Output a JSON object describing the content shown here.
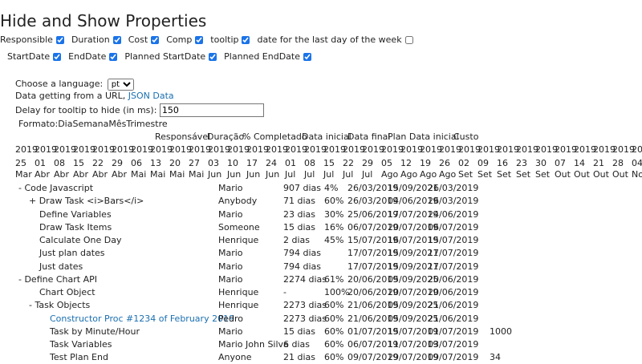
{
  "title": "Hide and Show Properties",
  "options_row1": [
    {
      "label": "Responsible",
      "checked": true
    },
    {
      "label": "Duration",
      "checked": true
    },
    {
      "label": "Cost",
      "checked": true
    },
    {
      "label": "Comp",
      "checked": true
    },
    {
      "label": "tooltip",
      "checked": true
    },
    {
      "label": "date for the last day of the week",
      "checked": false
    }
  ],
  "options_row2": [
    {
      "label": "StartDate",
      "checked": true
    },
    {
      "label": "EndDate",
      "checked": true
    },
    {
      "label": "Planned StartDate",
      "checked": true
    },
    {
      "label": "Planned EndDate",
      "checked": true
    }
  ],
  "language": {
    "label": "Choose a language:",
    "selected": "pt"
  },
  "data_source": {
    "text": "Data getting from a URL,",
    "link": "JSON Data"
  },
  "delay": {
    "label": "Delay for tooltip to hide (in ms):",
    "value": "150"
  },
  "format_label": "Formato:DiaSemanaMêsTrimestre",
  "columns": {
    "responsible": "Responsável",
    "duration": "Duração",
    "completed": "% Completado",
    "start": "Data inicial",
    "end": "Data final",
    "plan_start": "Plan Data inicial",
    "cost": "Custo"
  },
  "timeline": {
    "years": [
      "2019",
      "2019",
      "2019",
      "2019",
      "2019",
      "2019",
      "2019",
      "2019",
      "2019",
      "2019",
      "2019",
      "2019",
      "2019",
      "2019",
      "2019",
      "2019",
      "2019",
      "2019",
      "2019",
      "2019",
      "2019",
      "2019",
      "2019",
      "2019",
      "2019",
      "2019",
      "2019",
      "2019",
      "2019",
      "2019",
      "2019",
      "2019",
      "2019",
      "2019"
    ],
    "days": [
      "25",
      "01",
      "08",
      "15",
      "22",
      "29",
      "06",
      "13",
      "20",
      "27",
      "03",
      "10",
      "17",
      "24",
      "01",
      "08",
      "15",
      "22",
      "29",
      "05",
      "12",
      "19",
      "26",
      "02",
      "09",
      "16",
      "23",
      "30",
      "07",
      "14",
      "21",
      "28",
      "04",
      ""
    ],
    "months": [
      "Mar",
      "Abr",
      "Abr",
      "Abr",
      "Abr",
      "Abr",
      "Mai",
      "Mai",
      "Mai",
      "Mai",
      "Jun",
      "Jun",
      "Jun",
      "Jun",
      "Jul",
      "Jul",
      "Jul",
      "Jul",
      "Jul",
      "Ago",
      "Ago",
      "Ago",
      "Ago",
      "Set",
      "Set",
      "Set",
      "Set",
      "Set",
      "Out",
      "Out",
      "Out",
      "Out",
      "Nov",
      ""
    ]
  },
  "tasks": [
    {
      "name": "- Code Javascript",
      "indent": 0,
      "link": false,
      "responsible": "Mario",
      "duration": "907 dias",
      "completed": "4%",
      "start": "26/03/2019",
      "end": "15/09/2021",
      "plan_start": "26/03/2019",
      "cost": ""
    },
    {
      "name": "+ Draw Task <i>Bars</i>",
      "indent": 1,
      "link": false,
      "responsible": "Anybody",
      "duration": "71 dias",
      "completed": "60%",
      "start": "26/03/2019",
      "end": "04/06/2019",
      "plan_start": "26/03/2019",
      "cost": ""
    },
    {
      "name": "Define Variables",
      "indent": 2,
      "link": false,
      "responsible": "Mario",
      "duration": "23 dias",
      "completed": "30%",
      "start": "25/06/2019",
      "end": "17/07/2019",
      "plan_start": "24/06/2019",
      "cost": ""
    },
    {
      "name": "Draw Task Items",
      "indent": 2,
      "link": false,
      "responsible": "Someone",
      "duration": "15 dias",
      "completed": "16%",
      "start": "06/07/2019",
      "end": "20/07/2019",
      "plan_start": "06/07/2019",
      "cost": ""
    },
    {
      "name": "Calculate One Day",
      "indent": 2,
      "link": false,
      "responsible": "Henrique",
      "duration": "2 dias",
      "completed": "45%",
      "start": "15/07/2019",
      "end": "16/07/2019",
      "plan_start": "15/07/2019",
      "cost": ""
    },
    {
      "name": "Just plan dates",
      "indent": 2,
      "link": false,
      "responsible": "Mario",
      "duration": "794 dias",
      "completed": "",
      "start": "17/07/2019",
      "end": "15/09/2021",
      "plan_start": "17/07/2019",
      "cost": ""
    },
    {
      "name": "Just dates",
      "indent": 2,
      "link": false,
      "responsible": "Mario",
      "duration": "794 dias",
      "completed": "",
      "start": "17/07/2019",
      "end": "15/09/2021",
      "plan_start": "17/07/2019",
      "cost": ""
    },
    {
      "name": "- Define Chart API",
      "indent": 0,
      "link": false,
      "responsible": "Mario",
      "duration": "2274 dias",
      "completed": "61%",
      "start": "20/06/2019",
      "end": "05/09/2025",
      "plan_start": "20/06/2019",
      "cost": ""
    },
    {
      "name": "Chart Object",
      "indent": 2,
      "link": false,
      "responsible": "Henrique",
      "duration": "-",
      "completed": "100%",
      "start": "20/06/2019",
      "end": "20/07/2019",
      "plan_start": "20/06/2019",
      "cost": ""
    },
    {
      "name": "- Task Objects",
      "indent": 1,
      "link": false,
      "responsible": "Henrique",
      "duration": "2273 dias",
      "completed": "60%",
      "start": "21/06/2019",
      "end": "05/09/2025",
      "plan_start": "21/06/2019",
      "cost": ""
    },
    {
      "name": "Constructor Proc #1234 of February 2019",
      "indent": 3,
      "link": true,
      "responsible": "Pedro",
      "duration": "2273 dias",
      "completed": "60%",
      "start": "21/06/2019",
      "end": "05/09/2025",
      "plan_start": "21/06/2019",
      "cost": ""
    },
    {
      "name": "Task by Minute/Hour",
      "indent": 3,
      "link": false,
      "responsible": "Mario",
      "duration": "15 dias",
      "completed": "60%",
      "start": "01/07/2019",
      "end": "15/07/2019",
      "plan_start": "01/07/2019",
      "cost": "1000"
    },
    {
      "name": "Task Variables",
      "indent": 3,
      "link": false,
      "responsible": "Mario John Silva",
      "duration": "6 dias",
      "completed": "60%",
      "start": "06/07/2019",
      "end": "11/07/2019",
      "plan_start": "03/07/2019",
      "cost": ""
    },
    {
      "name": "Test Plan End",
      "indent": 3,
      "link": false,
      "responsible": "Anyone",
      "duration": "21 dias",
      "completed": "60%",
      "start": "09/07/2019",
      "end": "29/07/2019",
      "plan_start": "09/07/2019",
      "cost": "34"
    }
  ]
}
